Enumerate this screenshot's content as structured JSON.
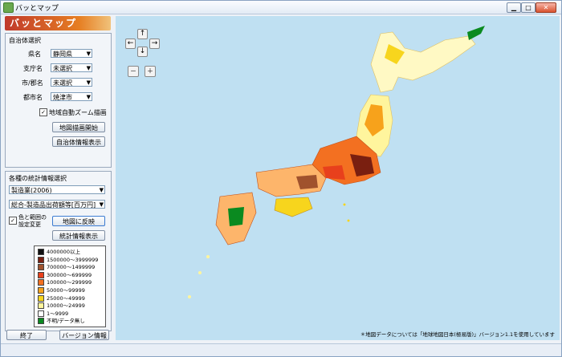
{
  "window": {
    "title": "バッとマップ",
    "min": "▁",
    "max": "□",
    "close": "✕"
  },
  "logo": {
    "text": "バッとマップ"
  },
  "municipality": {
    "group_title": "自治体選択",
    "prefecture": {
      "label": "県名",
      "value": "静岡県"
    },
    "branch": {
      "label": "支庁名",
      "value": "未選択"
    },
    "city_county": {
      "label": "市/郡名",
      "value": "未選択"
    },
    "town": {
      "label": "都市名",
      "value": "焼津市"
    },
    "auto_zoom": {
      "label": "地域自動ズーム描画",
      "checked": true
    },
    "draw_button": "地図描画開始",
    "info_button": "自治体情報表示"
  },
  "statistics": {
    "group_title": "各種の統計情報選択",
    "dataset": "製造業(2006)",
    "item": "総合-製造品出荷額等[百万円]",
    "color_change": {
      "label1": "色と範囲の",
      "label2": "設定変更",
      "checked": true
    },
    "map_reflect_button": "地図に反映",
    "stats_button": "統計情報表示",
    "legend": [
      {
        "label": "4000000以上",
        "color": "#111111"
      },
      {
        "label": "1500000～3999999",
        "color": "#7a1f10"
      },
      {
        "label": "700000～1499999",
        "color": "#a0522d"
      },
      {
        "label": "300000～699999",
        "color": "#e8401c"
      },
      {
        "label": "100000～299999",
        "color": "#f37021"
      },
      {
        "label": "50000～99999",
        "color": "#f7a21b"
      },
      {
        "label": "25000～49999",
        "color": "#f7d51d"
      },
      {
        "label": "10000～24999",
        "color": "#fff59d"
      },
      {
        "label": "1～9999",
        "color": "#ffffff"
      },
      {
        "label": "不明/データ無し",
        "color": "#0a8a20"
      }
    ]
  },
  "footer": {
    "exit_button": "終了",
    "version_button": "バージョン情報"
  },
  "map": {
    "note": "＊地図データについては「地球地図日本(極易版)」バージョン1.1を使用しています"
  },
  "nav": {
    "up": "↑",
    "down": "↓",
    "left": "←",
    "right": "→",
    "zoom_out": "－",
    "zoom_in": "＋"
  }
}
